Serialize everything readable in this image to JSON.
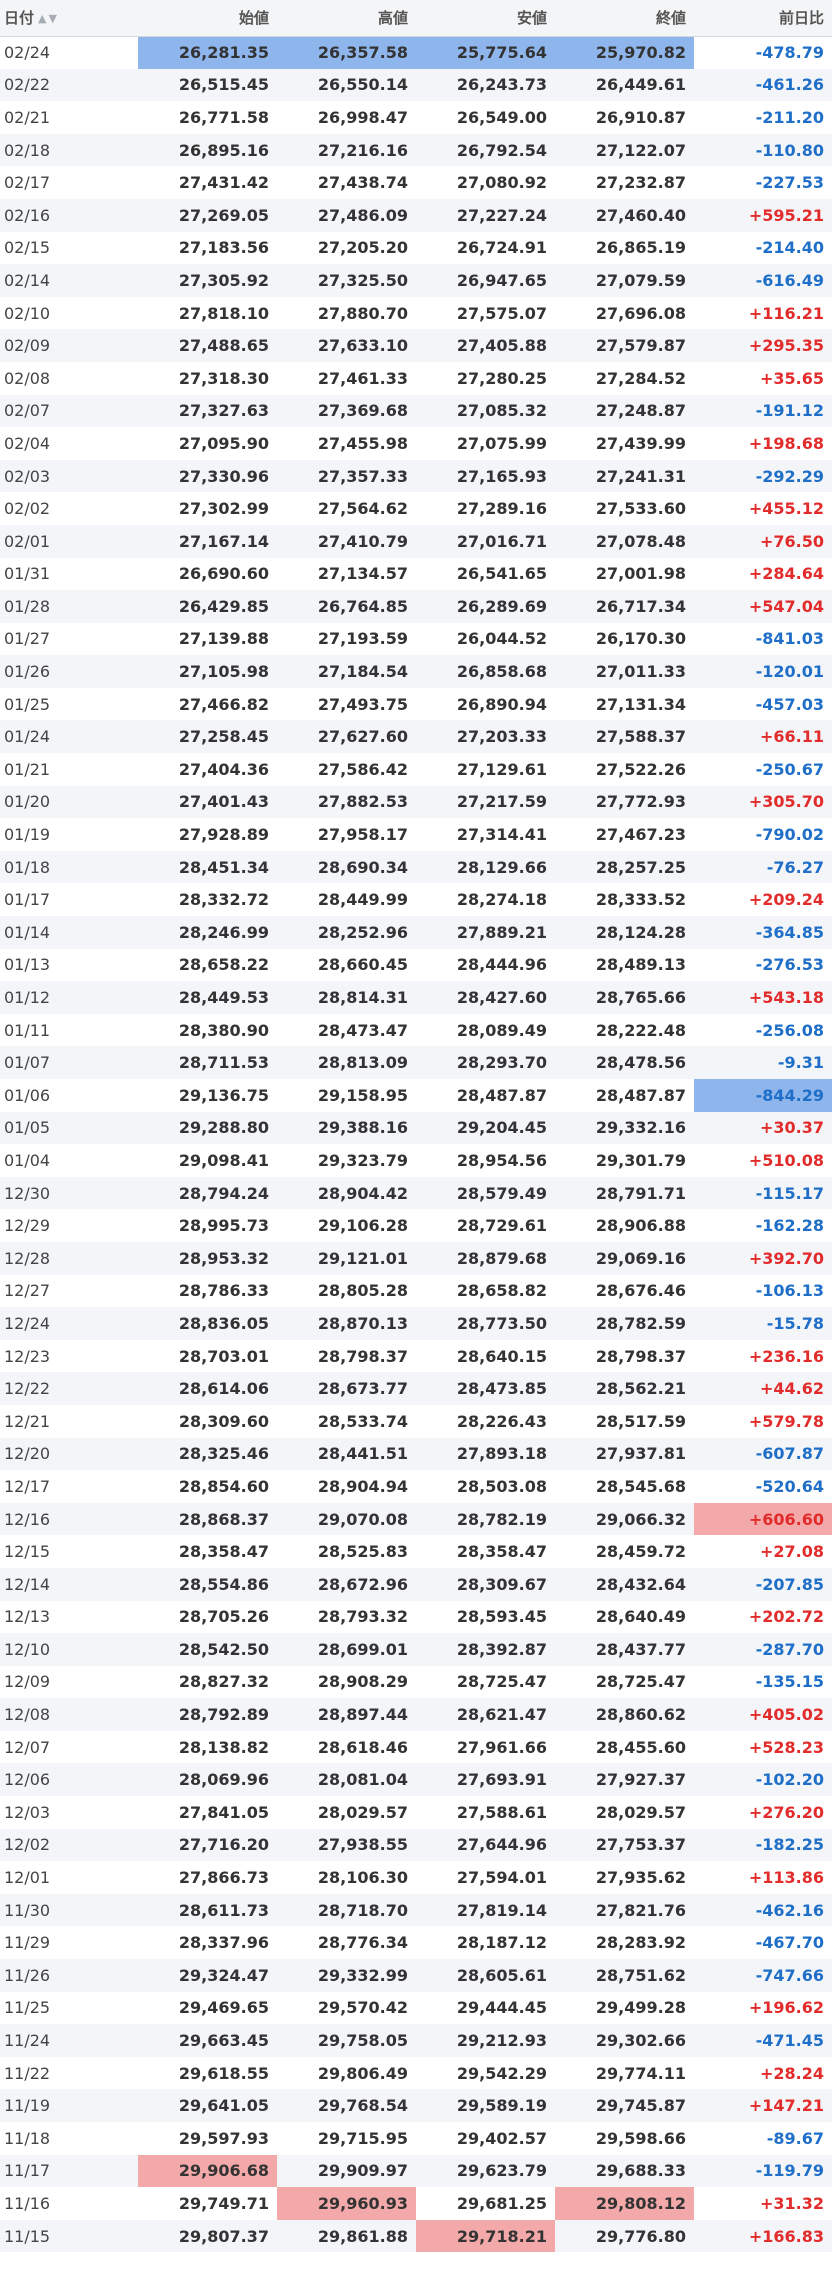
{
  "table": {
    "headers": {
      "date": "日付",
      "open": "始値",
      "high": "高値",
      "low": "安値",
      "close": "終値",
      "change": "前日比"
    },
    "rows": [
      {
        "date": "02/24",
        "open": "26,281.35",
        "high": "26,357.58",
        "low": "25,775.64",
        "close": "25,970.82",
        "change": "-478.79",
        "hl": [
          "open",
          "high",
          "low",
          "close"
        ],
        "hl_type": "low"
      },
      {
        "date": "02/22",
        "open": "26,515.45",
        "high": "26,550.14",
        "low": "26,243.73",
        "close": "26,449.61",
        "change": "-461.26"
      },
      {
        "date": "02/21",
        "open": "26,771.58",
        "high": "26,998.47",
        "low": "26,549.00",
        "close": "26,910.87",
        "change": "-211.20"
      },
      {
        "date": "02/18",
        "open": "26,895.16",
        "high": "27,216.16",
        "low": "26,792.54",
        "close": "27,122.07",
        "change": "-110.80"
      },
      {
        "date": "02/17",
        "open": "27,431.42",
        "high": "27,438.74",
        "low": "27,080.92",
        "close": "27,232.87",
        "change": "-227.53"
      },
      {
        "date": "02/16",
        "open": "27,269.05",
        "high": "27,486.09",
        "low": "27,227.24",
        "close": "27,460.40",
        "change": "+595.21"
      },
      {
        "date": "02/15",
        "open": "27,183.56",
        "high": "27,205.20",
        "low": "26,724.91",
        "close": "26,865.19",
        "change": "-214.40"
      },
      {
        "date": "02/14",
        "open": "27,305.92",
        "high": "27,325.50",
        "low": "26,947.65",
        "close": "27,079.59",
        "change": "-616.49"
      },
      {
        "date": "02/10",
        "open": "27,818.10",
        "high": "27,880.70",
        "low": "27,575.07",
        "close": "27,696.08",
        "change": "+116.21"
      },
      {
        "date": "02/09",
        "open": "27,488.65",
        "high": "27,633.10",
        "low": "27,405.88",
        "close": "27,579.87",
        "change": "+295.35"
      },
      {
        "date": "02/08",
        "open": "27,318.30",
        "high": "27,461.33",
        "low": "27,280.25",
        "close": "27,284.52",
        "change": "+35.65"
      },
      {
        "date": "02/07",
        "open": "27,327.63",
        "high": "27,369.68",
        "low": "27,085.32",
        "close": "27,248.87",
        "change": "-191.12"
      },
      {
        "date": "02/04",
        "open": "27,095.90",
        "high": "27,455.98",
        "low": "27,075.99",
        "close": "27,439.99",
        "change": "+198.68"
      },
      {
        "date": "02/03",
        "open": "27,330.96",
        "high": "27,357.33",
        "low": "27,165.93",
        "close": "27,241.31",
        "change": "-292.29"
      },
      {
        "date": "02/02",
        "open": "27,302.99",
        "high": "27,564.62",
        "low": "27,289.16",
        "close": "27,533.60",
        "change": "+455.12"
      },
      {
        "date": "02/01",
        "open": "27,167.14",
        "high": "27,410.79",
        "low": "27,016.71",
        "close": "27,078.48",
        "change": "+76.50"
      },
      {
        "date": "01/31",
        "open": "26,690.60",
        "high": "27,134.57",
        "low": "26,541.65",
        "close": "27,001.98",
        "change": "+284.64"
      },
      {
        "date": "01/28",
        "open": "26,429.85",
        "high": "26,764.85",
        "low": "26,289.69",
        "close": "26,717.34",
        "change": "+547.04"
      },
      {
        "date": "01/27",
        "open": "27,139.88",
        "high": "27,193.59",
        "low": "26,044.52",
        "close": "26,170.30",
        "change": "-841.03"
      },
      {
        "date": "01/26",
        "open": "27,105.98",
        "high": "27,184.54",
        "low": "26,858.68",
        "close": "27,011.33",
        "change": "-120.01"
      },
      {
        "date": "01/25",
        "open": "27,466.82",
        "high": "27,493.75",
        "low": "26,890.94",
        "close": "27,131.34",
        "change": "-457.03"
      },
      {
        "date": "01/24",
        "open": "27,258.45",
        "high": "27,627.60",
        "low": "27,203.33",
        "close": "27,588.37",
        "change": "+66.11"
      },
      {
        "date": "01/21",
        "open": "27,404.36",
        "high": "27,586.42",
        "low": "27,129.61",
        "close": "27,522.26",
        "change": "-250.67"
      },
      {
        "date": "01/20",
        "open": "27,401.43",
        "high": "27,882.53",
        "low": "27,217.59",
        "close": "27,772.93",
        "change": "+305.70"
      },
      {
        "date": "01/19",
        "open": "27,928.89",
        "high": "27,958.17",
        "low": "27,314.41",
        "close": "27,467.23",
        "change": "-790.02"
      },
      {
        "date": "01/18",
        "open": "28,451.34",
        "high": "28,690.34",
        "low": "28,129.66",
        "close": "28,257.25",
        "change": "-76.27"
      },
      {
        "date": "01/17",
        "open": "28,332.72",
        "high": "28,449.99",
        "low": "28,274.18",
        "close": "28,333.52",
        "change": "+209.24"
      },
      {
        "date": "01/14",
        "open": "28,246.99",
        "high": "28,252.96",
        "low": "27,889.21",
        "close": "28,124.28",
        "change": "-364.85"
      },
      {
        "date": "01/13",
        "open": "28,658.22",
        "high": "28,660.45",
        "low": "28,444.96",
        "close": "28,489.13",
        "change": "-276.53"
      },
      {
        "date": "01/12",
        "open": "28,449.53",
        "high": "28,814.31",
        "low": "28,427.60",
        "close": "28,765.66",
        "change": "+543.18"
      },
      {
        "date": "01/11",
        "open": "28,380.90",
        "high": "28,473.47",
        "low": "28,089.49",
        "close": "28,222.48",
        "change": "-256.08"
      },
      {
        "date": "01/07",
        "open": "28,711.53",
        "high": "28,813.09",
        "low": "28,293.70",
        "close": "28,478.56",
        "change": "-9.31"
      },
      {
        "date": "01/06",
        "open": "29,136.75",
        "high": "29,158.95",
        "low": "28,487.87",
        "close": "28,487.87",
        "change": "-844.29",
        "hl": [
          "change"
        ],
        "hl_type": "low"
      },
      {
        "date": "01/05",
        "open": "29,288.80",
        "high": "29,388.16",
        "low": "29,204.45",
        "close": "29,332.16",
        "change": "+30.37"
      },
      {
        "date": "01/04",
        "open": "29,098.41",
        "high": "29,323.79",
        "low": "28,954.56",
        "close": "29,301.79",
        "change": "+510.08"
      },
      {
        "date": "12/30",
        "open": "28,794.24",
        "high": "28,904.42",
        "low": "28,579.49",
        "close": "28,791.71",
        "change": "-115.17"
      },
      {
        "date": "12/29",
        "open": "28,995.73",
        "high": "29,106.28",
        "low": "28,729.61",
        "close": "28,906.88",
        "change": "-162.28"
      },
      {
        "date": "12/28",
        "open": "28,953.32",
        "high": "29,121.01",
        "low": "28,879.68",
        "close": "29,069.16",
        "change": "+392.70"
      },
      {
        "date": "12/27",
        "open": "28,786.33",
        "high": "28,805.28",
        "low": "28,658.82",
        "close": "28,676.46",
        "change": "-106.13"
      },
      {
        "date": "12/24",
        "open": "28,836.05",
        "high": "28,870.13",
        "low": "28,773.50",
        "close": "28,782.59",
        "change": "-15.78"
      },
      {
        "date": "12/23",
        "open": "28,703.01",
        "high": "28,798.37",
        "low": "28,640.15",
        "close": "28,798.37",
        "change": "+236.16"
      },
      {
        "date": "12/22",
        "open": "28,614.06",
        "high": "28,673.77",
        "low": "28,473.85",
        "close": "28,562.21",
        "change": "+44.62"
      },
      {
        "date": "12/21",
        "open": "28,309.60",
        "high": "28,533.74",
        "low": "28,226.43",
        "close": "28,517.59",
        "change": "+579.78"
      },
      {
        "date": "12/20",
        "open": "28,325.46",
        "high": "28,441.51",
        "low": "27,893.18",
        "close": "27,937.81",
        "change": "-607.87"
      },
      {
        "date": "12/17",
        "open": "28,854.60",
        "high": "28,904.94",
        "low": "28,503.08",
        "close": "28,545.68",
        "change": "-520.64"
      },
      {
        "date": "12/16",
        "open": "28,868.37",
        "high": "29,070.08",
        "low": "28,782.19",
        "close": "29,066.32",
        "change": "+606.60",
        "hl": [
          "change"
        ],
        "hl_type": "high"
      },
      {
        "date": "12/15",
        "open": "28,358.47",
        "high": "28,525.83",
        "low": "28,358.47",
        "close": "28,459.72",
        "change": "+27.08"
      },
      {
        "date": "12/14",
        "open": "28,554.86",
        "high": "28,672.96",
        "low": "28,309.67",
        "close": "28,432.64",
        "change": "-207.85"
      },
      {
        "date": "12/13",
        "open": "28,705.26",
        "high": "28,793.32",
        "low": "28,593.45",
        "close": "28,640.49",
        "change": "+202.72"
      },
      {
        "date": "12/10",
        "open": "28,542.50",
        "high": "28,699.01",
        "low": "28,392.87",
        "close": "28,437.77",
        "change": "-287.70"
      },
      {
        "date": "12/09",
        "open": "28,827.32",
        "high": "28,908.29",
        "low": "28,725.47",
        "close": "28,725.47",
        "change": "-135.15"
      },
      {
        "date": "12/08",
        "open": "28,792.89",
        "high": "28,897.44",
        "low": "28,621.47",
        "close": "28,860.62",
        "change": "+405.02"
      },
      {
        "date": "12/07",
        "open": "28,138.82",
        "high": "28,618.46",
        "low": "27,961.66",
        "close": "28,455.60",
        "change": "+528.23"
      },
      {
        "date": "12/06",
        "open": "28,069.96",
        "high": "28,081.04",
        "low": "27,693.91",
        "close": "27,927.37",
        "change": "-102.20"
      },
      {
        "date": "12/03",
        "open": "27,841.05",
        "high": "28,029.57",
        "low": "27,588.61",
        "close": "28,029.57",
        "change": "+276.20"
      },
      {
        "date": "12/02",
        "open": "27,716.20",
        "high": "27,938.55",
        "low": "27,644.96",
        "close": "27,753.37",
        "change": "-182.25"
      },
      {
        "date": "12/01",
        "open": "27,866.73",
        "high": "28,106.30",
        "low": "27,594.01",
        "close": "27,935.62",
        "change": "+113.86"
      },
      {
        "date": "11/30",
        "open": "28,611.73",
        "high": "28,718.70",
        "low": "27,819.14",
        "close": "27,821.76",
        "change": "-462.16"
      },
      {
        "date": "11/29",
        "open": "28,337.96",
        "high": "28,776.34",
        "low": "28,187.12",
        "close": "28,283.92",
        "change": "-467.70"
      },
      {
        "date": "11/26",
        "open": "29,324.47",
        "high": "29,332.99",
        "low": "28,605.61",
        "close": "28,751.62",
        "change": "-747.66"
      },
      {
        "date": "11/25",
        "open": "29,469.65",
        "high": "29,570.42",
        "low": "29,444.45",
        "close": "29,499.28",
        "change": "+196.62"
      },
      {
        "date": "11/24",
        "open": "29,663.45",
        "high": "29,758.05",
        "low": "29,212.93",
        "close": "29,302.66",
        "change": "-471.45"
      },
      {
        "date": "11/22",
        "open": "29,618.55",
        "high": "29,806.49",
        "low": "29,542.29",
        "close": "29,774.11",
        "change": "+28.24"
      },
      {
        "date": "11/19",
        "open": "29,641.05",
        "high": "29,768.54",
        "low": "29,589.19",
        "close": "29,745.87",
        "change": "+147.21"
      },
      {
        "date": "11/18",
        "open": "29,597.93",
        "high": "29,715.95",
        "low": "29,402.57",
        "close": "29,598.66",
        "change": "-89.67"
      },
      {
        "date": "11/17",
        "open": "29,906.68",
        "high": "29,909.97",
        "low": "29,623.79",
        "close": "29,688.33",
        "change": "-119.79",
        "hl": [
          "open"
        ],
        "hl_type": "high"
      },
      {
        "date": "11/16",
        "open": "29,749.71",
        "high": "29,960.93",
        "low": "29,681.25",
        "close": "29,808.12",
        "change": "+31.32",
        "hl": [
          "high",
          "close"
        ],
        "hl_type": "high"
      },
      {
        "date": "11/15",
        "open": "29,807.37",
        "high": "29,861.88",
        "low": "29,718.21",
        "close": "29,776.80",
        "change": "+166.83",
        "hl": [
          "low"
        ],
        "hl_type": "high"
      }
    ]
  },
  "colors": {
    "up": "#e22c2c",
    "down": "#1f6fc8",
    "highlight_low": "#8fb6ec",
    "highlight_high": "#f3a9a9"
  },
  "icons": {
    "sort": "sort-arrows-icon"
  }
}
